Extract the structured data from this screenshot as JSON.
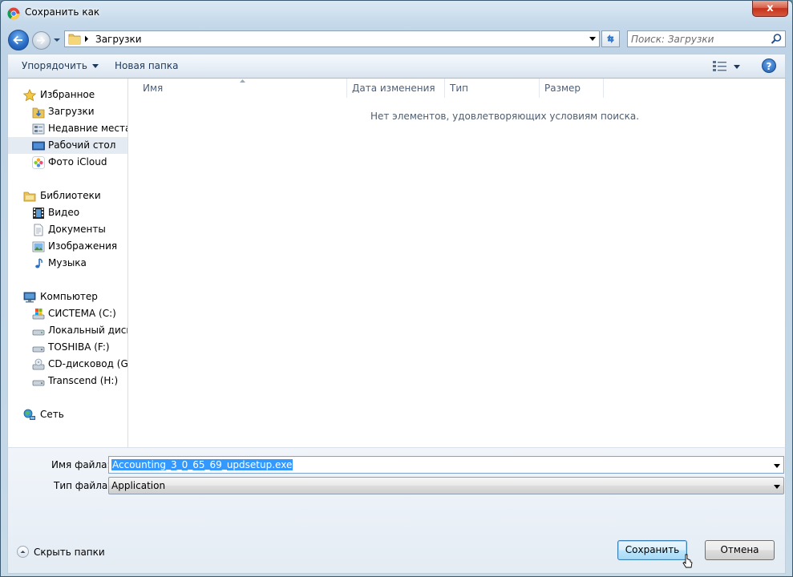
{
  "window": {
    "title": "Сохранить как",
    "close_label": "x"
  },
  "address": {
    "crumb": "Загрузки"
  },
  "search": {
    "placeholder": "Поиск: Загрузки"
  },
  "toolbar": {
    "organize_label": "Упорядочить",
    "new_folder_label": "Новая папка",
    "help_label": "?"
  },
  "nav": {
    "favorites": {
      "label": "Избранное",
      "items": [
        {
          "label": "Загрузки",
          "icon": "downloads-folder-icon"
        },
        {
          "label": "Недавние места",
          "icon": "recent-places-icon"
        },
        {
          "label": "Рабочий стол",
          "icon": "desktop-icon",
          "selected": true
        },
        {
          "label": "Фото iCloud",
          "icon": "icloud-photos-icon"
        }
      ]
    },
    "libraries": {
      "label": "Библиотеки",
      "items": [
        {
          "label": "Видео",
          "icon": "video-icon"
        },
        {
          "label": "Документы",
          "icon": "documents-icon"
        },
        {
          "label": "Изображения",
          "icon": "pictures-icon"
        },
        {
          "label": "Музыка",
          "icon": "music-icon"
        }
      ]
    },
    "computer": {
      "label": "Компьютер",
      "items": [
        {
          "label": "СИСТЕМА (C:)",
          "icon": "system-drive-icon"
        },
        {
          "label": "Локальный диск (",
          "icon": "local-drive-icon"
        },
        {
          "label": "TOSHIBA (F:)",
          "icon": "removable-drive-icon"
        },
        {
          "label": "CD-дисковод (G:)",
          "icon": "cd-drive-icon"
        },
        {
          "label": "Transcend (H:)",
          "icon": "removable-drive-icon"
        }
      ]
    },
    "network": {
      "label": "Сеть"
    }
  },
  "list": {
    "columns": [
      "Имя",
      "Дата изменения",
      "Тип",
      "Размер"
    ],
    "empty_message": "Нет элементов, удовлетворяющих условиям поиска."
  },
  "form": {
    "filename_label": "Имя файла:",
    "filename_value": "Accounting_3_0_65_69_updsetup.exe",
    "filetype_label": "Тип файла:",
    "filetype_value": "Application"
  },
  "footer": {
    "hide_folders_label": "Скрыть папки",
    "save_label": "Сохранить",
    "cancel_label": "Отмена"
  },
  "colors": {
    "accent": "#3399ff",
    "toolbar_text": "#1e395b"
  }
}
